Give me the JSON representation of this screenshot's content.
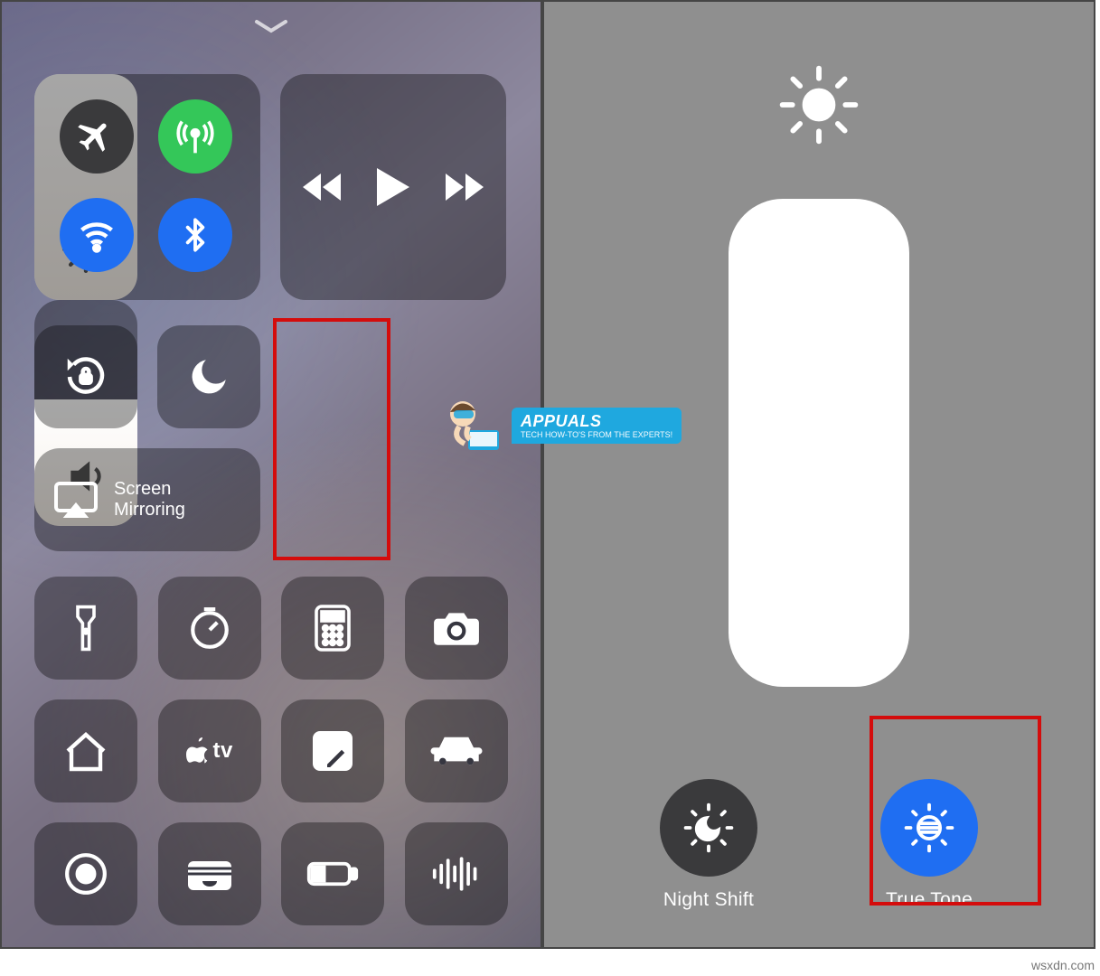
{
  "controlCenter": {
    "connectivity": {
      "airplane": {
        "on": false,
        "color": "#3a3a3c"
      },
      "cellular": {
        "on": true,
        "color": "#34c759"
      },
      "wifi": {
        "on": true,
        "color": "#1f6ef2"
      },
      "bluetooth": {
        "on": true,
        "color": "#1f6ef2"
      }
    },
    "media": {
      "prev": "prev",
      "play": "play",
      "next": "next"
    },
    "orientationLock": "rotation-lock-icon",
    "doNotDisturb": "moon-icon",
    "screenMirroring": {
      "label_line1": "Screen",
      "label_line2": "Mirroring"
    },
    "brightnessSlider": {
      "level": 1.0
    },
    "volumeSlider": {
      "level": 0.56
    },
    "shortcuts": [
      "flashlight-icon",
      "timer-icon",
      "calculator-icon",
      "camera-icon",
      "home-icon",
      "appletv-icon",
      "notes-icon",
      "car-icon",
      "screen-record-icon",
      "wallet-icon",
      "low-power-icon",
      "voice-memos-icon"
    ]
  },
  "brightnessPanel": {
    "nightShift": {
      "label": "Night Shift",
      "on": false,
      "color": "#3a3a3c"
    },
    "trueTone": {
      "label": "True Tone",
      "on": true,
      "color": "#1f6ef2"
    }
  },
  "watermark": {
    "brand": "APPUALS",
    "tagline": "TECH HOW-TO'S FROM THE EXPERTS!"
  },
  "attribution": "wsxdn.com"
}
